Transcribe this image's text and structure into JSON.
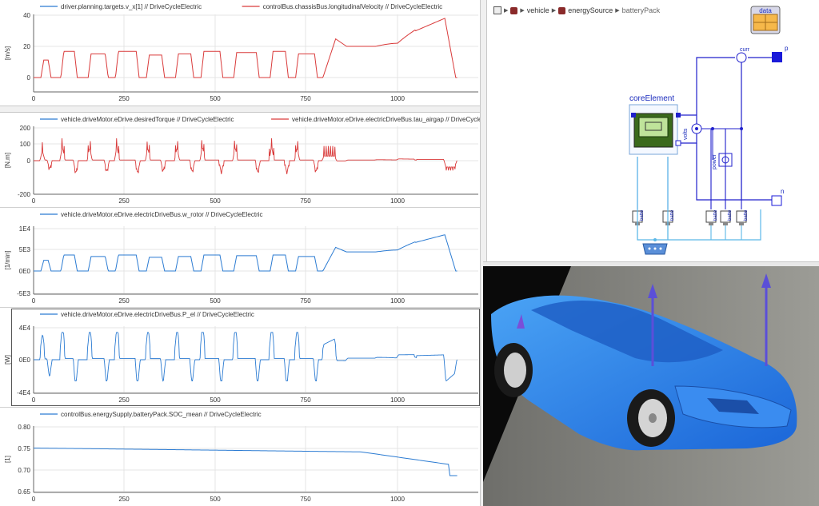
{
  "colors": {
    "blue": "#2b7bd2",
    "red": "#d93a3a",
    "grid": "#e4e4e4",
    "axis": "#444444",
    "diagram_blue": "#2020cc",
    "wire_cyan": "#5bb8e8",
    "car_blue": "#2f86e8",
    "floor": "#8a8a86"
  },
  "icons": {
    "breadcrumb_root": "diagram-icon",
    "breadcrumb_pkg": "package-icon",
    "arrow": "chevron-right-icon"
  },
  "breadcrumb": {
    "items": [
      "vehicle",
      "energySource",
      "batteryPack"
    ]
  },
  "plots": [
    {
      "series": [
        {
          "name": "driver.planning.targets.v_x[1] // DriveCycleElectric",
          "color": "#2b7bd2"
        },
        {
          "name": "controlBus.chassisBus.longitudinalVelocity // DriveCycleElectric",
          "color": "#d93a3a"
        }
      ],
      "unit": "[m/s]",
      "yticks": [
        "0",
        "20",
        "40"
      ],
      "xticks": [
        "0",
        "250",
        "500",
        "750",
        "1000"
      ]
    },
    {
      "series": [
        {
          "name": "vehicle.driveMotor.eDrive.desiredTorque // DriveCycleElectric",
          "color": "#2b7bd2"
        },
        {
          "name": "vehicle.driveMotor.eDrive.electricDriveBus.tau_airgap // DriveCycleElectric",
          "color": "#d93a3a"
        }
      ],
      "unit": "[N.m]",
      "yticks": [
        "-200",
        "0",
        "100",
        "200"
      ],
      "xticks": [
        "0",
        "250",
        "500",
        "750",
        "1000"
      ]
    },
    {
      "series": [
        {
          "name": "vehicle.driveMotor.eDrive.electricDriveBus.w_rotor // DriveCycleElectric",
          "color": "#2b7bd2"
        }
      ],
      "unit": "[1/min]",
      "yticks": [
        "-5E3",
        "0E0",
        "5E3",
        "1E4"
      ],
      "xticks": [
        "0",
        "250",
        "500",
        "750",
        "1000"
      ]
    },
    {
      "series": [
        {
          "name": "vehicle.driveMotor.eDrive.electricDriveBus.P_el // DriveCycleElectric",
          "color": "#2b7bd2"
        }
      ],
      "unit": "[W]",
      "yticks": [
        "-4E4",
        "0E0",
        "4E4"
      ],
      "xticks": [
        "0",
        "250",
        "500",
        "750",
        "1000"
      ]
    },
    {
      "series": [
        {
          "name": "controlBus.energySupply.batteryPack.SOC_mean // DriveCycleElectric",
          "color": "#2b7bd2"
        }
      ],
      "unit": "[1]",
      "yticks": [
        "0.65",
        "0.70",
        "0.75",
        "0.80"
      ],
      "xticks": [
        "0",
        "250",
        "500",
        "750",
        "1000"
      ]
    }
  ],
  "diagram": {
    "data_label": "data",
    "core_label": "coreElement",
    "curr_label": "curr",
    "volts_label": "volts",
    "power_label": "power",
    "port_p": "p",
    "port_n": "n",
    "sensor_labels": [
      "batte",
      "batte",
      "batte",
      "batte",
      "batte"
    ]
  }
}
